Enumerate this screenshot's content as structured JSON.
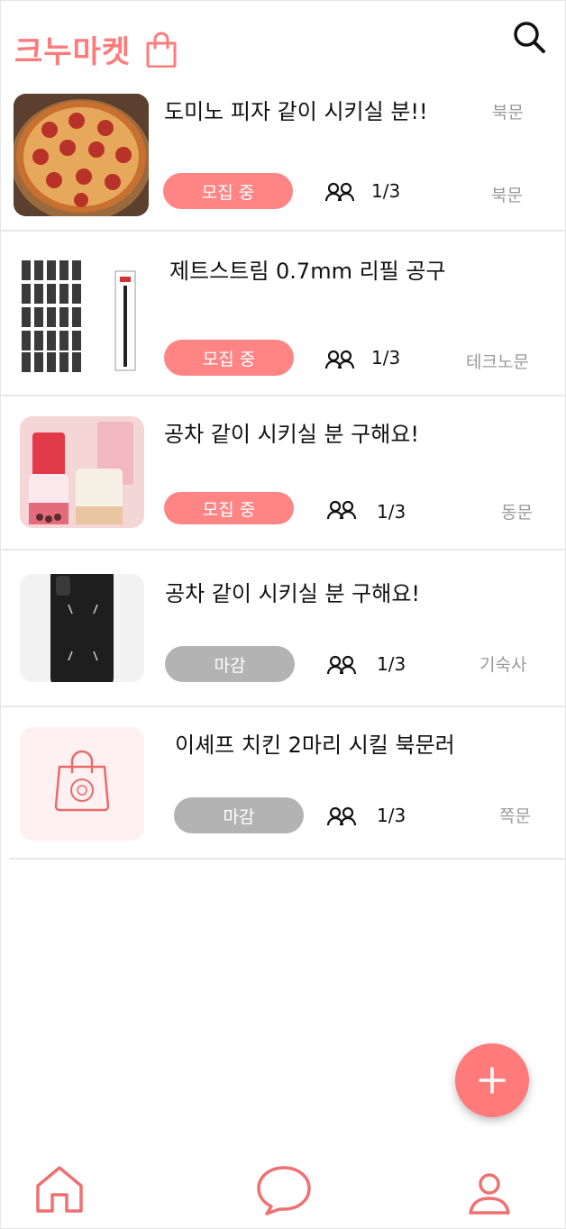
{
  "app": {
    "title": "크누마켓"
  },
  "icons": {
    "brand": "shopping-bag-icon",
    "search": "search-icon",
    "people": "people-icon",
    "fab": "plus-icon",
    "nav_home": "home-icon",
    "nav_chat": "chat-icon",
    "nav_profile": "profile-icon"
  },
  "colors": {
    "accent": "#ff7b7b",
    "badge_open": "#ff8585",
    "badge_closed": "#b3b3b3"
  },
  "posts": [
    {
      "title": "도미노 피자 같이 시키실 분!!",
      "top_location": "북문",
      "status": "모집 중",
      "count": "1/3",
      "location": "북문",
      "thumb": "pizza"
    },
    {
      "title": "제트스트림 0.7mm 리필 공구",
      "status": "모집 중",
      "count": "1/3",
      "location": "테크노문",
      "thumb": "pen-refills"
    },
    {
      "title": "공차 같이 시키실 분 구해요!",
      "status": "모집 중",
      "count": "1/3",
      "location": "동문",
      "thumb": "drinks"
    },
    {
      "title": "공차 같이 시키실 분 구해요!",
      "status": "마감",
      "count": "1/3",
      "location": "기숙사",
      "thumb": "phone-case"
    },
    {
      "title": "이셰프 치킨 2마리 시킬 북문러",
      "status": "마감",
      "count": "1/3",
      "location": "쪽문",
      "thumb": "placeholder-bag"
    }
  ]
}
